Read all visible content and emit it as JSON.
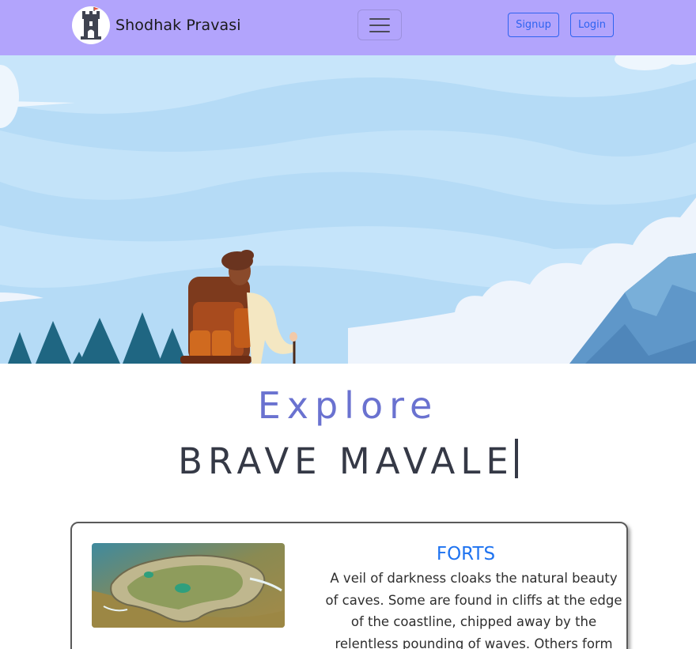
{
  "navbar": {
    "brand_name": "Shodhak Pravasi",
    "logo_icon": "fort-tower-icon",
    "menu_icon": "hamburger-menu-icon",
    "signup_label": "Signup",
    "login_label": "Login",
    "background_color": "#b2a4fc",
    "button_color": "#2e63f0"
  },
  "hero": {
    "illustration": "hiker-with-backpack-mountains-clouds-trees"
  },
  "headline": {
    "explore": "Explore",
    "brave": "BRAVE MAVALE",
    "explore_color": "#6a72d0",
    "brave_color": "#353946"
  },
  "card": {
    "image": "aerial-sea-fort-island",
    "title": "FORTS",
    "title_color": "#1f73f0",
    "text": "A veil of darkness cloaks the natural beauty of caves. Some are found in cliffs at the edge of the coastline, chipped away by the relentless pounding of waves. Others form"
  }
}
